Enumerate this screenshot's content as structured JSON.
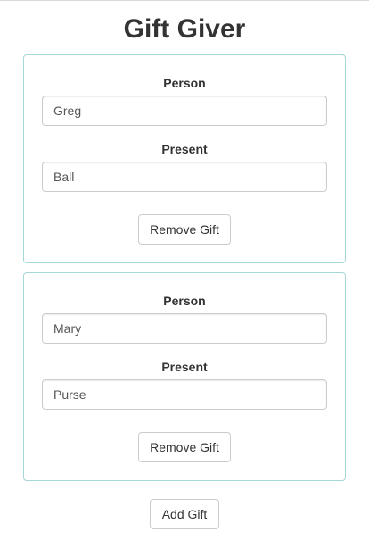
{
  "app": {
    "title": "Gift Giver"
  },
  "gifts": [
    {
      "person_label": "Person",
      "person_value": "Greg",
      "present_label": "Present",
      "present_value": "Ball",
      "remove_label": "Remove Gift"
    },
    {
      "person_label": "Person",
      "person_value": "Mary",
      "present_label": "Present",
      "present_value": "Purse",
      "remove_label": "Remove Gift"
    }
  ],
  "actions": {
    "add_label": "Add Gift"
  },
  "colors": {
    "card_border": "#a6d8d4",
    "input_border": "#cccccc",
    "text": "#333333"
  }
}
